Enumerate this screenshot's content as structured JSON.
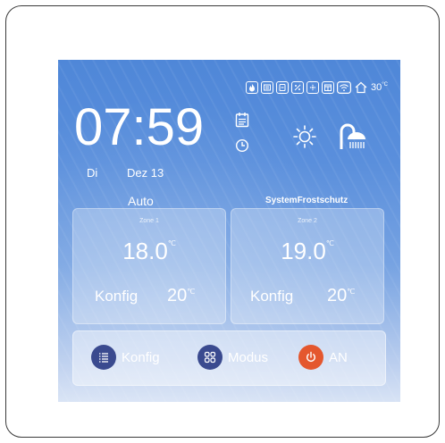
{
  "status": {
    "icons": [
      "flame-icon",
      "heat-pump-icon",
      "tank-icon",
      "defrost-icon",
      "fan-icon",
      "calendar-grid-icon",
      "wifi-icon",
      "home-icon"
    ],
    "outdoor_temp": "30",
    "temp_unit": "°C"
  },
  "clock": {
    "time": "07:59",
    "day": "Di",
    "date": "Dez 13"
  },
  "modes": {
    "left": "Auto",
    "right": "SystemFrostschutz"
  },
  "zones": [
    {
      "title": "Zone 1",
      "temp": "18.0",
      "unit": "℃",
      "konfig_label": "Konfig",
      "konfig_value": "20",
      "konfig_unit": "℃"
    },
    {
      "title": "Zone 2",
      "temp": "19.0",
      "unit": "℃",
      "konfig_label": "Konfig",
      "konfig_value": "20",
      "konfig_unit": "℃"
    }
  ],
  "bottom": {
    "konfig_label": "Konfig",
    "modus_label": "Modus",
    "power_label": "AN"
  },
  "colors": {
    "screen_top": "#4f87d8",
    "navy_button": "#3a4a8f",
    "power_button": "#e4572e"
  }
}
